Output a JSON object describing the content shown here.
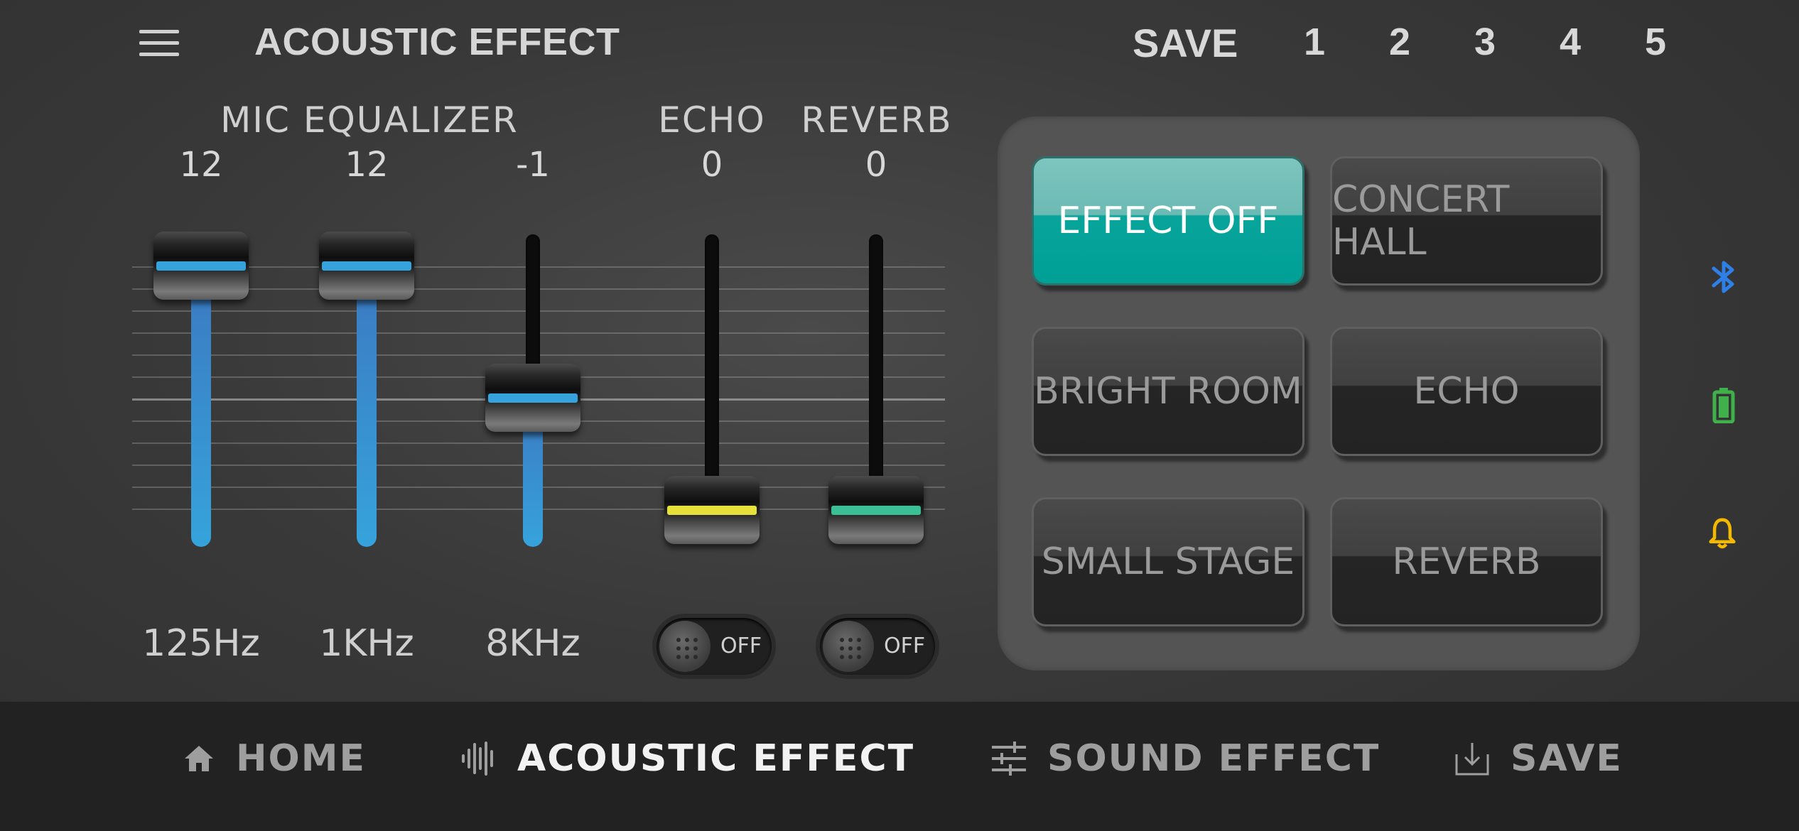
{
  "header": {
    "title": "ACOUSTIC EFFECT",
    "save_label": "SAVE",
    "preset_slots": [
      "1",
      "2",
      "3",
      "4",
      "5"
    ]
  },
  "mic_equalizer": {
    "label": "MIC EQUALIZER",
    "bands": [
      {
        "frequency": "125Hz",
        "value": "12",
        "level": 12
      },
      {
        "frequency": "1KHz",
        "value": "12",
        "level": 12
      },
      {
        "frequency": "8KHz",
        "value": "-1",
        "level": -1
      }
    ],
    "range": [
      -12,
      12
    ]
  },
  "echo": {
    "label": "ECHO",
    "value": "0",
    "level": 0,
    "toggle_state": "OFF",
    "range": [
      0,
      12
    ]
  },
  "reverb": {
    "label": "REVERB",
    "value": "0",
    "level": 0,
    "toggle_state": "OFF",
    "range": [
      0,
      12
    ]
  },
  "presets": [
    {
      "label": "EFFECT OFF",
      "active": true
    },
    {
      "label": "CONCERT HALL",
      "active": false
    },
    {
      "label": "BRIGHT ROOM",
      "active": false
    },
    {
      "label": "ECHO",
      "active": false
    },
    {
      "label": "SMALL STAGE",
      "active": false
    },
    {
      "label": "REVERB",
      "active": false
    }
  ],
  "status_icons": [
    "bluetooth-icon",
    "battery-icon",
    "bell-icon"
  ],
  "bottom_nav": [
    {
      "label": "HOME",
      "icon": "home-icon",
      "active": false
    },
    {
      "label": "ACOUSTIC EFFECT",
      "icon": "waveform-icon",
      "active": true
    },
    {
      "label": "SOUND EFFECT",
      "icon": "sliders-icon",
      "active": false
    },
    {
      "label": "SAVE",
      "icon": "download-icon",
      "active": false
    }
  ],
  "colors": {
    "accent_teal": "#00a096",
    "eq_blue": "#36a3dc",
    "echo_stripe": "#e5e03a",
    "reverb_stripe": "#3bbf95",
    "bluetooth": "#2f7fe8",
    "battery": "#3fb04a",
    "bell": "#f5b800"
  }
}
